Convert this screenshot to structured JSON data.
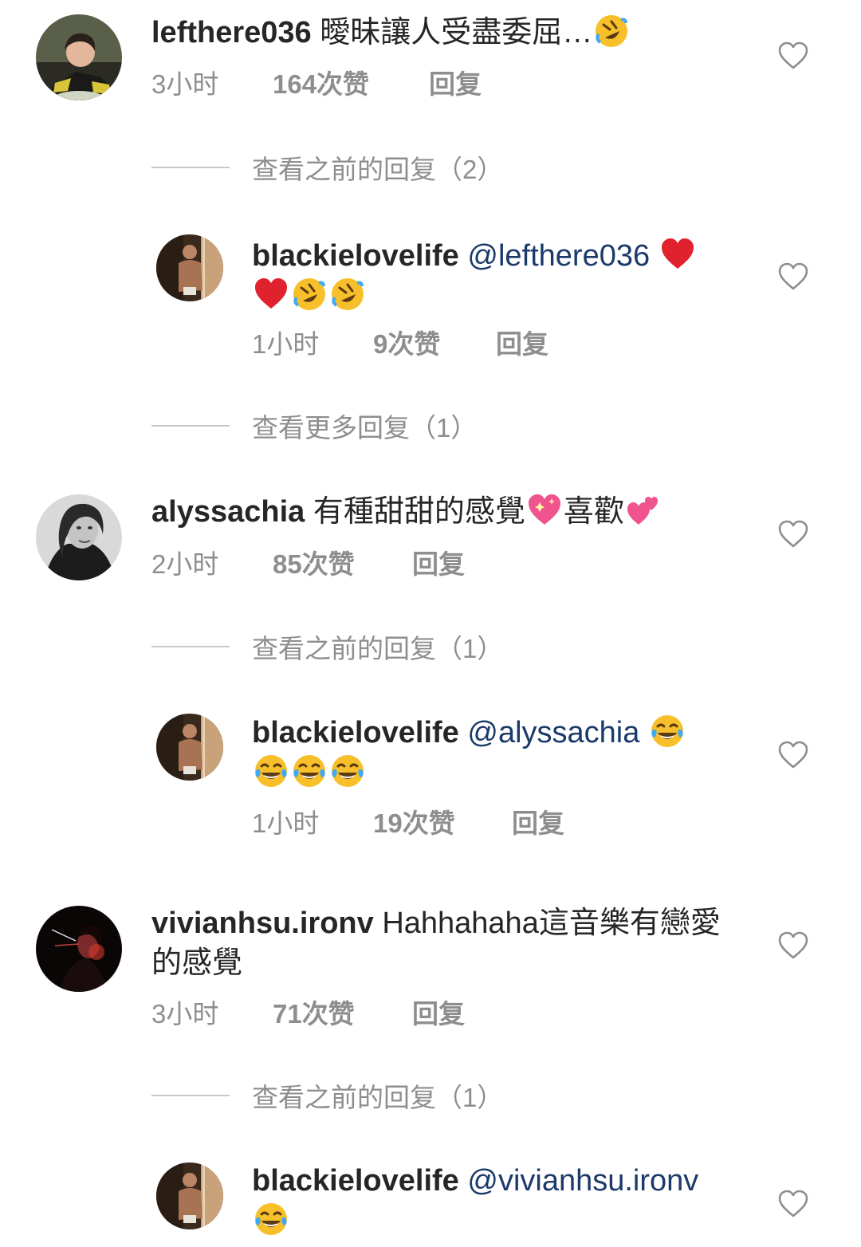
{
  "comments": [
    {
      "username": "lefthere036",
      "text": "曖昧讓人受盡委屈…",
      "emoji_after": [
        "rofl-emoji"
      ],
      "time": "3小时",
      "likes": "164次赞",
      "reply": "回复",
      "view_replies": "查看之前的回复（2）",
      "replies": [
        {
          "username": "blackielovelife",
          "mention": "@lefthere036",
          "emojis": [
            "red-heart-emoji",
            "red-heart-emoji",
            "rofl-emoji",
            "rofl-emoji"
          ],
          "time": "1小时",
          "likes": "9次赞",
          "reply": "回复"
        }
      ],
      "view_more_replies": "查看更多回复（1）"
    },
    {
      "username": "alyssachia",
      "text": "有種甜甜的感覺",
      "text2": "喜歡",
      "time": "2小时",
      "likes": "85次赞",
      "reply": "回复",
      "view_replies": "查看之前的回复（1）",
      "replies": [
        {
          "username": "blackielovelife",
          "mention": "@alyssachia",
          "emojis": [
            "tears-of-joy-emoji",
            "tears-of-joy-emoji",
            "tears-of-joy-emoji",
            "tears-of-joy-emoji"
          ],
          "time": "1小时",
          "likes": "19次赞",
          "reply": "回复"
        }
      ]
    },
    {
      "username": "vivianhsu.ironv",
      "text": "Hahhahaha這音樂有戀愛的感覺",
      "time": "3小时",
      "likes": "71次赞",
      "reply": "回复",
      "view_replies": "查看之前的回复（1）",
      "replies": [
        {
          "username": "blackielovelife",
          "mention": "@vivianhsu.ironv",
          "emojis": [
            "tears-of-joy-emoji"
          ]
        }
      ]
    }
  ],
  "colors": {
    "text": "#262626",
    "meta": "#8e8e8e",
    "mention": "#1b3a6b",
    "divider": "#c7c7c7"
  }
}
